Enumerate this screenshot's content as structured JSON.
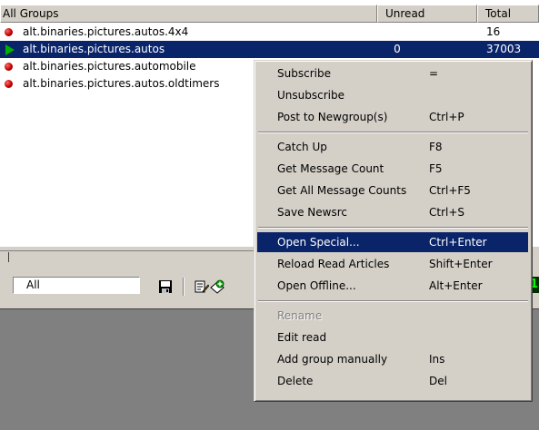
{
  "list": {
    "columns": {
      "name": "All Groups",
      "unread": "Unread",
      "total": "Total"
    },
    "rows": [
      {
        "name": "alt.binaries.pictures.autos.4x4",
        "unread": "",
        "total": "16",
        "icon": "red-ball-icon",
        "selected": false
      },
      {
        "name": "alt.binaries.pictures.autos",
        "unread": "0",
        "total": "37003",
        "icon": "green-arrow-icon",
        "selected": true
      },
      {
        "name": "alt.binaries.pictures.automobile",
        "unread": "",
        "total": "",
        "icon": "red-ball-icon",
        "selected": false
      },
      {
        "name": "alt.binaries.pictures.autos.oldtimers",
        "unread": "",
        "total": "",
        "icon": "red-ball-icon",
        "selected": false
      }
    ]
  },
  "toolbar": {
    "filter_value": "All",
    "icons": [
      "save-icon",
      "properties-icon",
      "add-group-icon"
    ],
    "indicator_text": "1"
  },
  "context_menu": {
    "groups": [
      [
        {
          "label": "Subscribe",
          "shortcut": "=",
          "disabled": false,
          "highlighted": false
        },
        {
          "label": "Unsubscribe",
          "shortcut": "",
          "disabled": false,
          "highlighted": false
        },
        {
          "label": "Post to Newgroup(s)",
          "shortcut": "Ctrl+P",
          "disabled": false,
          "highlighted": false
        }
      ],
      [
        {
          "label": "Catch Up",
          "shortcut": "F8",
          "disabled": false,
          "highlighted": false
        },
        {
          "label": "Get Message Count",
          "shortcut": "F5",
          "disabled": false,
          "highlighted": false
        },
        {
          "label": "Get All Message Counts",
          "shortcut": "Ctrl+F5",
          "disabled": false,
          "highlighted": false
        },
        {
          "label": "Save Newsrc",
          "shortcut": "Ctrl+S",
          "disabled": false,
          "highlighted": false
        }
      ],
      [
        {
          "label": "Open Special...",
          "shortcut": "Ctrl+Enter",
          "disabled": false,
          "highlighted": true
        },
        {
          "label": "Reload Read Articles",
          "shortcut": "Shift+Enter",
          "disabled": false,
          "highlighted": false
        },
        {
          "label": "Open Offline...",
          "shortcut": "Alt+Enter",
          "disabled": false,
          "highlighted": false
        }
      ],
      [
        {
          "label": "Rename",
          "shortcut": "",
          "disabled": true,
          "highlighted": false
        },
        {
          "label": "Edit read",
          "shortcut": "",
          "disabled": false,
          "highlighted": false
        },
        {
          "label": "Add group manually",
          "shortcut": "Ins",
          "disabled": false,
          "highlighted": false
        },
        {
          "label": "Delete",
          "shortcut": "Del",
          "disabled": false,
          "highlighted": false
        }
      ]
    ]
  },
  "colors": {
    "selection": "#0a246a",
    "window_face": "#d4d0c8",
    "disabled_text": "#808080"
  }
}
